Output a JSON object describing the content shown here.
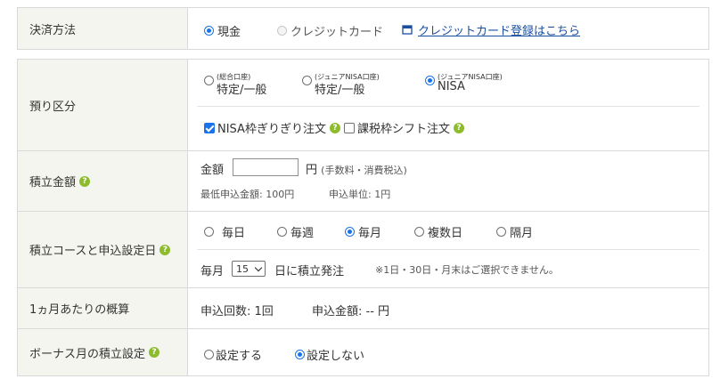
{
  "payment": {
    "label": "決済方法",
    "options": [
      {
        "label": "現金",
        "selected": true
      },
      {
        "label": "クレジットカード",
        "selected": false,
        "disabled": true
      }
    ],
    "register_link": "クレジットカード登録はこちら"
  },
  "account": {
    "label": "預り区分",
    "options": [
      {
        "sub": "(総合口座)",
        "main": "特定/一般",
        "selected": false
      },
      {
        "sub": "(ジュニアNISA口座)",
        "main": "特定/一般",
        "selected": false
      },
      {
        "sub": "(ジュニアNISA口座)",
        "main": "NISA",
        "selected": true
      }
    ],
    "checks": [
      {
        "label": "NISA枠ぎりぎり注文",
        "checked": true
      },
      {
        "label": "課税枠シフト注文",
        "checked": false
      }
    ]
  },
  "amount": {
    "label": "積立金額",
    "prefix": "金額",
    "value": "",
    "unit": "円",
    "note": "(手数料・消費税込)",
    "min": "最低申込金額: 100円",
    "step": "申込単位: 1円"
  },
  "course": {
    "label": "積立コースと申込設定日",
    "options": [
      {
        "label": "毎日",
        "selected": false
      },
      {
        "label": "毎週",
        "selected": false
      },
      {
        "label": "毎月",
        "selected": true
      },
      {
        "label": "複数日",
        "selected": false
      },
      {
        "label": "隔月",
        "selected": false
      }
    ],
    "monthly_prefix": "毎月",
    "day_value": "15",
    "monthly_suffix": "日に積立発注",
    "note": "※1日・30日・月末はご選択できません。"
  },
  "estimate": {
    "label": "1ヵ月あたりの概算",
    "count": "申込回数: 1回",
    "amount": "申込金額: -- 円"
  },
  "bonus": {
    "label": "ボーナス月の積立設定",
    "options": [
      {
        "label": "設定する",
        "selected": false
      },
      {
        "label": "設定しない",
        "selected": true
      }
    ]
  },
  "help_glyph": "?"
}
